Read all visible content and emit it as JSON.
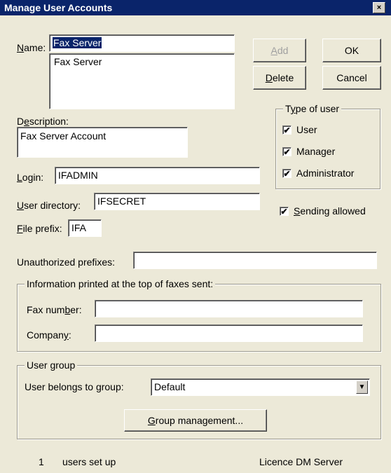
{
  "window": {
    "title": "Manage User Accounts",
    "close_glyph": "×"
  },
  "name": {
    "label_accel": "N",
    "label_rest": "ame:",
    "value": "Fax Server",
    "list_items": [
      "Fax Server"
    ]
  },
  "buttons": {
    "add_accel": "A",
    "add_rest": "dd",
    "ok": "OK",
    "delete_accel": "D",
    "delete_rest": "elete",
    "cancel": "Cancel",
    "group_mgmt_accel": "G",
    "group_mgmt_rest": "roup management..."
  },
  "description": {
    "label_pre": "D",
    "label_accel": "e",
    "label_rest": "scription:",
    "value": "Fax Server Account"
  },
  "type_of_user": {
    "legend_pre": "T",
    "legend_accel": "y",
    "legend_rest": "pe of user",
    "options": [
      {
        "label": "User",
        "checked": true
      },
      {
        "label": "Manager",
        "checked": true
      },
      {
        "label": "Administrator",
        "checked": true
      }
    ]
  },
  "login": {
    "label_accel": "L",
    "label_rest": "ogin:",
    "value": "IFADMIN"
  },
  "user_directory": {
    "label_accel": "U",
    "label_rest": "ser directory:",
    "value": "IFSECRET"
  },
  "sending_allowed": {
    "label_accel": "S",
    "label_rest": "ending allowed",
    "checked": true
  },
  "file_prefix": {
    "label_accel": "F",
    "label_rest": "ile prefix:",
    "value": "IFA"
  },
  "unauthorized_prefixes": {
    "label": "Unauthorized prefixes:",
    "value": ""
  },
  "fax_info": {
    "legend": "Information printed at the top of faxes sent:",
    "fax_number_pre": "Fax num",
    "fax_number_accel": "b",
    "fax_number_rest": "er:",
    "fax_number_value": "",
    "company_pre": "Compan",
    "company_accel": "y",
    "company_rest": ":",
    "company_value": ""
  },
  "user_group": {
    "legend": "User group",
    "belongs_label": "User belongs to group:",
    "selected": "Default",
    "arrow_glyph": "▼"
  },
  "status": {
    "count": "1",
    "count_label": "users set up",
    "licence": "Licence DM Server"
  },
  "icons": {
    "check_glyph": "✔"
  }
}
